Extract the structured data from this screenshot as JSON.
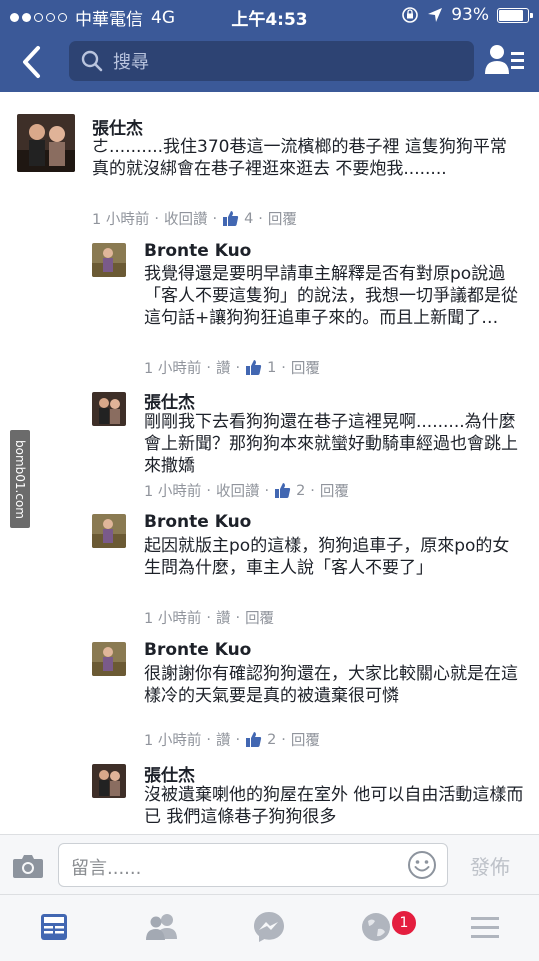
{
  "status_bar": {
    "carrier": "中華電信",
    "network": "4G",
    "time": "上午4:53",
    "battery": "93%",
    "battery_level": 0.93
  },
  "nav": {
    "search_placeholder": "搜尋"
  },
  "comments": [
    {
      "name": "張仕杰",
      "text": "ㄜ..........我住370巷這一流檳榔的巷子裡 這隻狗狗平常真的就沒綁會在巷子裡逛來逛去 不要炮我........",
      "time": "1 小時前",
      "action": "收回讚",
      "likes": "4",
      "reply": "回覆"
    },
    {
      "name": "Bronte Kuo",
      "text": "我覺得還是要明早請車主解釋是否有對原po說過「客人不要這隻狗」的說法，我想一切爭議都是從這句話+讓狗狗狂追車子來的。而且上新聞了…",
      "time": "1 小時前",
      "action": "讚",
      "likes": "1",
      "reply": "回覆"
    },
    {
      "name": "張仕杰",
      "text": "剛剛我下去看狗狗還在巷子這裡晃啊.........為什麼會上新聞？那狗狗本來就蠻好動騎車經過也會跳上來撒嬌",
      "time": "1 小時前",
      "action": "收回讚",
      "likes": "2",
      "reply": "回覆"
    },
    {
      "name": "Bronte Kuo",
      "text": "起因就版主po的這樣，狗狗追車子，原來po的女生問為什麼，車主人說「客人不要了」",
      "time": "1 小時前",
      "action": "讚",
      "reply": "回覆"
    },
    {
      "name": "Bronte Kuo",
      "text": "很謝謝你有確認狗狗還在，大家比較關心就是在這樣冷的天氣要是真的被遺棄很可憐",
      "time": "1 小時前",
      "action": "讚",
      "likes": "2",
      "reply": "回覆"
    },
    {
      "name": "張仕杰",
      "text": "沒被遺棄喇他的狗屋在室外 他可以自由活動這樣而已 我們這條巷子狗狗很多",
      "time": "",
      "action": "",
      "reply": ""
    }
  ],
  "watermark": "bomb01.com",
  "composer": {
    "placeholder": "留言......",
    "post_label": "發佈"
  },
  "tabbar": {
    "notification_count": "1"
  },
  "colors": {
    "brand": "#3b5998",
    "like_blue": "#4267b2",
    "meta_gray": "#90949c"
  }
}
